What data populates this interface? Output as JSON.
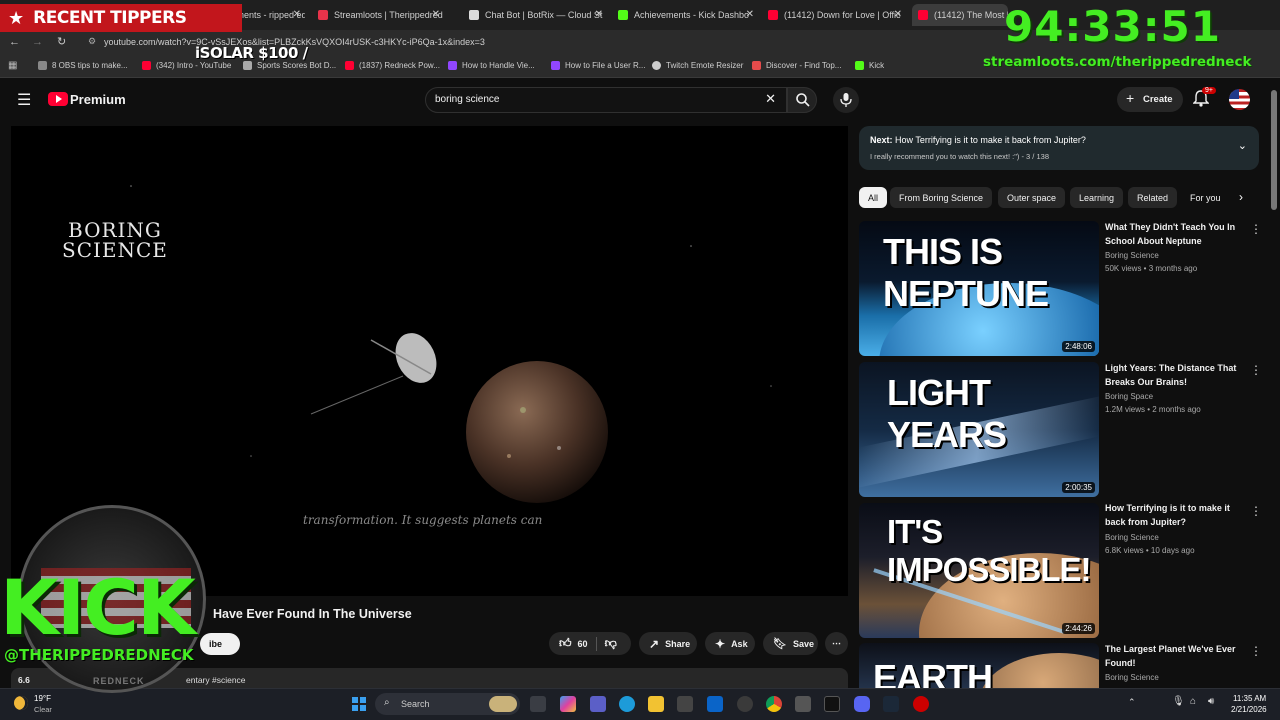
{
  "browser": {
    "tabs": [
      {
        "label": "Stream Elements - ripped ed",
        "color": "#d92f2f"
      },
      {
        "label": "Streamloots | Therippedred",
        "color": "#e8334a"
      },
      {
        "label": "Chat Bot | BotRix — Cloud St",
        "color": "#dcdcdc"
      },
      {
        "label": "Achievements - Kick Dashbo",
        "color": "#53fc18"
      },
      {
        "label": "(11412) Down for Love | Offic",
        "color": "#ff0033"
      },
      {
        "label": "(11412) The Most Bi",
        "color": "#ff0033"
      }
    ],
    "url": "youtube.com/watch?v=9C-vSsJEXos&list=PLBZckKsVQXOI4rUSK-c3HKYc-iP6Qa-1x&index=3",
    "bookmarks": [
      {
        "label": "8 OBS tips to make...",
        "color": "#888"
      },
      {
        "label": "(342) Intro - YouTube",
        "color": "#ff0033"
      },
      {
        "label": "Sports Scores Bot D...",
        "color": "#aaa"
      },
      {
        "label": "(1837) Redneck Pow...",
        "color": "#ff0033"
      },
      {
        "label": "How to Handle Vie...",
        "color": "#9146ff"
      },
      {
        "label": "How to File a User R...",
        "color": "#9146ff"
      },
      {
        "label": "Twitch Emote Resizer",
        "color": "#ccc"
      },
      {
        "label": "Discover - Find Top...",
        "color": "#e54b4b"
      },
      {
        "label": "Kick",
        "color": "#53fc18"
      }
    ]
  },
  "overlay": {
    "recent_tippers": "RECENT TIPPERS",
    "tipper_item": "iSOLAR $100 /",
    "timer": "94:33:51",
    "streamloots_url": "streamloots.com/therippedredneck",
    "kick_logo": "KICK",
    "kick_handle": "@THERIPPEDREDNECK",
    "badge_text": "REDNECK"
  },
  "youtube": {
    "logo_text": "Premium",
    "search_value": "boring science",
    "create_label": "Create",
    "notif_count": "9+",
    "video": {
      "brand_line1": "BORING",
      "brand_line2": "SCIENCE",
      "subtitle": "transformation. It suggests planets can",
      "title": "Have Ever Found In The Universe",
      "subscribe_partial": "ibe",
      "likes": "60",
      "share": "Share",
      "ask": "Ask",
      "save": "Save",
      "desc_views": "6.6",
      "desc_tags": "entary #science"
    },
    "playlist": {
      "next_label": "Next:",
      "next_title": "How Terrifying is it to make it back from Jupiter?",
      "next_sub": "I really recommend you to watch this next! :\") - 3 / 138"
    },
    "chips": [
      "All",
      "From Boring Science",
      "Outer space",
      "Learning",
      "Related",
      "For you"
    ],
    "recommendations": [
      {
        "title": "What They Didn't Teach You In School About Neptune",
        "channel": "Boring Science",
        "meta": "50K views • 3 months ago",
        "duration": "2:48:06",
        "thumb_text": "THIS IS NEPTUNE"
      },
      {
        "title": "Light Years: The Distance That Breaks Our Brains!",
        "channel": "Boring Space",
        "meta": "1.2M views • 2 months ago",
        "duration": "2:00:35",
        "thumb_text": "LIGHT YEARS"
      },
      {
        "title": "How Terrifying is it to make it back from Jupiter?",
        "channel": "Boring Science",
        "meta": "6.8K views • 10 days ago",
        "duration": "2:44:26",
        "thumb_text": "IT'S IMPOSSIBLE!"
      },
      {
        "title": "The Largest Planet We've Ever Found!",
        "channel": "Boring Science",
        "meta": "",
        "duration": "",
        "thumb_text": "EARTH"
      }
    ]
  },
  "taskbar": {
    "weather_temp": "19°F",
    "weather_desc": "Clear",
    "search_placeholder": "Search",
    "time": "11:35 AM",
    "date": "2/21/2026"
  }
}
